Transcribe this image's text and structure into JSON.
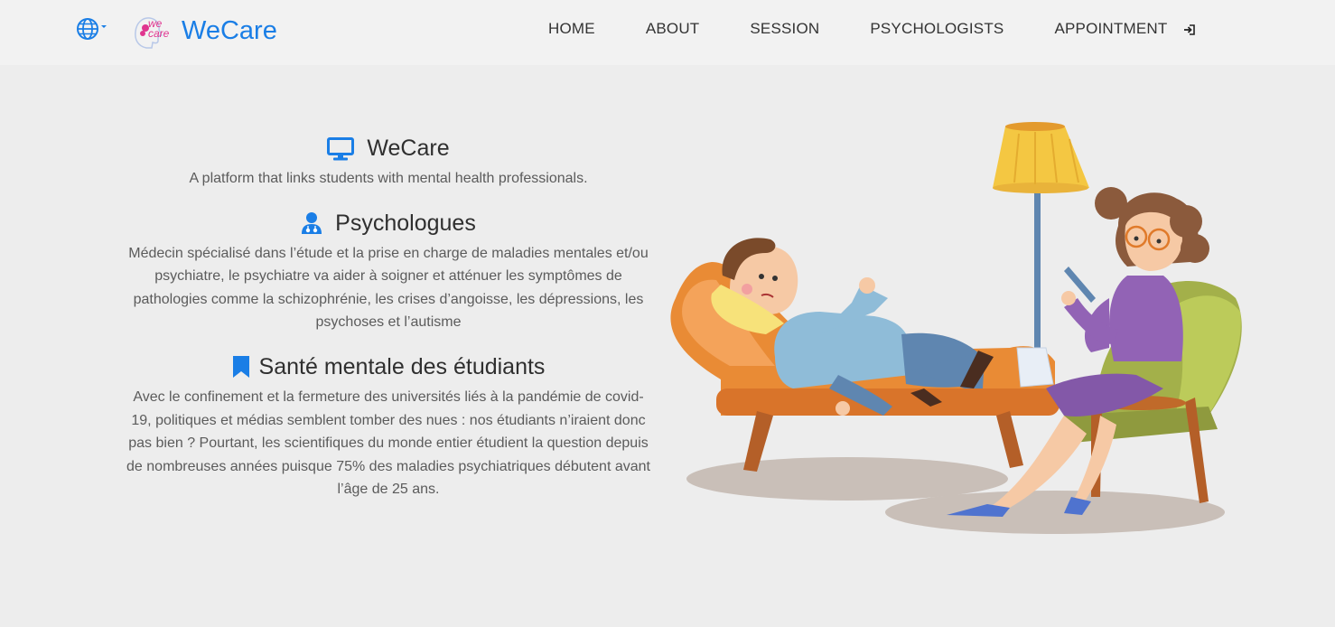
{
  "header": {
    "language_icon": "globe-icon",
    "logo_text": "we care",
    "brand": "WeCare",
    "nav": [
      "HOME",
      "ABOUT",
      "SESSION",
      "PSYCHOLOGISTS",
      "APPOINTMENT"
    ],
    "logout_icon": "sign-in-icon"
  },
  "sections": [
    {
      "icon": "desktop-icon",
      "title": "WeCare",
      "text": "A platform that links students with mental health professionals."
    },
    {
      "icon": "user-doctor-icon",
      "title": "Psychologues",
      "text": "Médecin spécialisé dans l’étude et la prise en charge de maladies mentales et/ou psychiatre, le psychiatre va aider à soigner et atténuer les symptômes de pathologies comme la schizophrénie, les crises d’angoisse, les dépressions, les psychoses et l’autisme"
    },
    {
      "icon": "bookmark-icon",
      "title": "Santé mentale des étudiants",
      "text": "Avec le confinement et la fermeture des universités liés à la pandémie de covid-19, politiques et médias semblent tomber des nues : nos étudiants n’iraient donc pas bien ? Pourtant, les scientifiques du monde entier étudient la question depuis de nombreuses années puisque 75% des maladies psychiatriques débutent avant l’âge de 25 ans."
    }
  ],
  "colors": {
    "accent": "#1a7ee6",
    "logo_pink": "#e0358f",
    "nav_bg": "#f2f2f2",
    "page_bg": "#ededed"
  }
}
